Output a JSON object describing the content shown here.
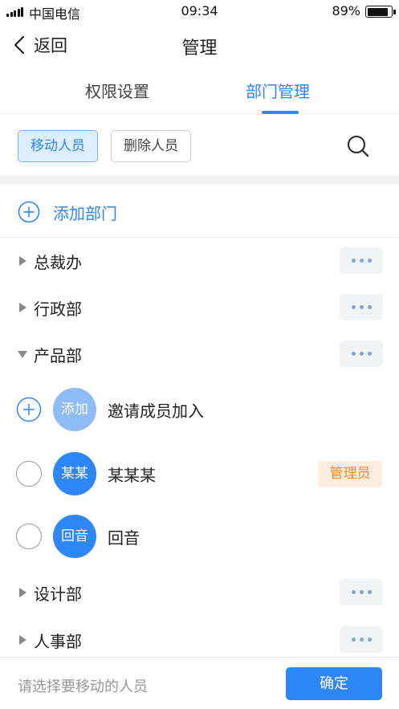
{
  "status": {
    "carrier": "中国电信",
    "time": "09:34",
    "battery": "89%"
  },
  "nav": {
    "back_label": "返回",
    "title": "管理"
  },
  "tabs": [
    {
      "label": "权限设置"
    },
    {
      "label": "部门管理",
      "active": true
    }
  ],
  "actions": {
    "move": "移动人员",
    "delete": "删除人员"
  },
  "add_dept": "添加部门",
  "departments": [
    {
      "name": "总裁办",
      "expanded": false
    },
    {
      "name": "行政部",
      "expanded": false
    },
    {
      "name": "产品部",
      "expanded": true
    },
    {
      "name": "设计部",
      "expanded": false
    },
    {
      "name": "人事部",
      "expanded": false
    }
  ],
  "members": [
    {
      "avatar": "添加",
      "name": "邀请成员加入",
      "avatar_color": "#8fbcf7"
    },
    {
      "avatar": "某某",
      "name": "某某某",
      "badge": "管理员",
      "avatar_color": "#2f86f6"
    },
    {
      "avatar": "回音",
      "name": "回音",
      "avatar_color": "#2f86f6"
    }
  ],
  "footer": {
    "hint": "请选择要移动的人员",
    "confirm": "确定"
  },
  "colors": {
    "accent": "#2f86f6",
    "badge_text": "#f08c2a",
    "badge_bg": "#fdeee0"
  }
}
